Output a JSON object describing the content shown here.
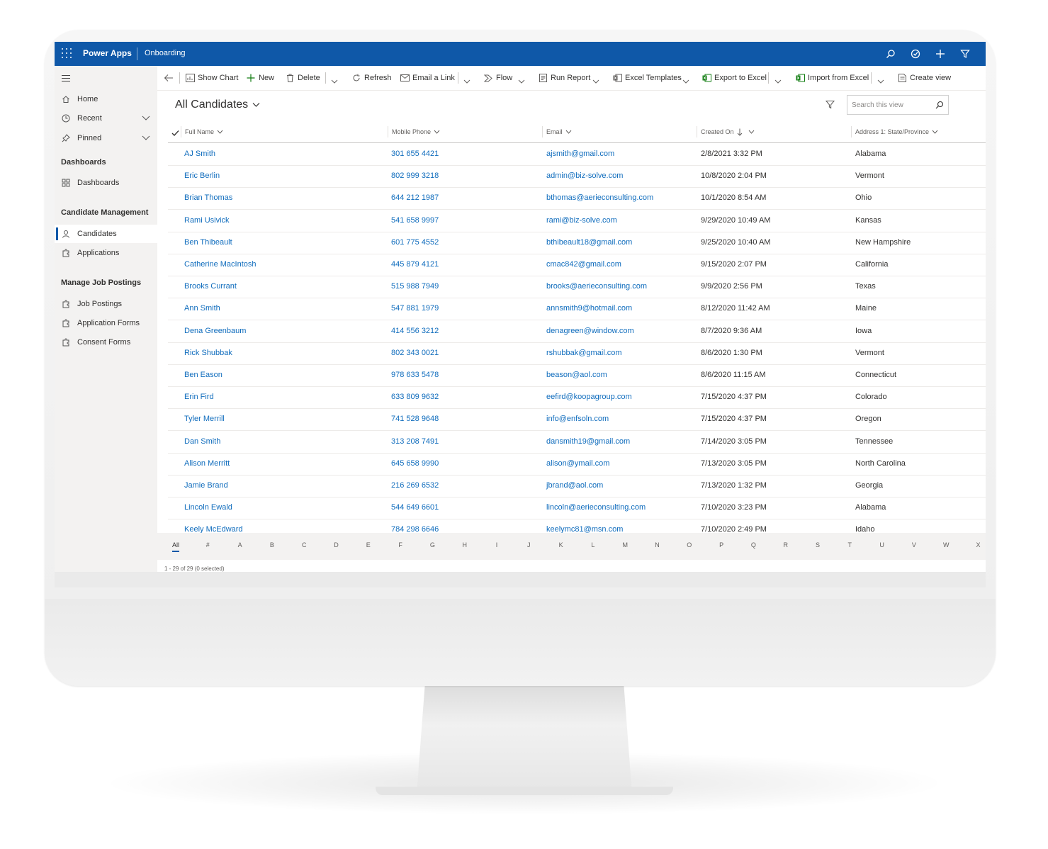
{
  "topbar": {
    "app_name": "Power Apps",
    "area": "Onboarding",
    "bg_color": "#0f58a8",
    "icons": [
      "search-icon",
      "assistant-icon",
      "new-icon",
      "advanced-filter-icon"
    ]
  },
  "sidebar": {
    "items": [
      {
        "label": "Home",
        "icon": "home-icon"
      },
      {
        "label": "Recent",
        "icon": "clock-icon"
      },
      {
        "label": "Pinned",
        "icon": "pin-icon"
      }
    ],
    "groups": [
      {
        "title": "Dashboards",
        "items": [
          {
            "label": "Dashboards",
            "icon": "dashboard-icon"
          }
        ]
      },
      {
        "title": "Candidate Management",
        "items": [
          {
            "label": "Candidates",
            "icon": "person-icon",
            "active": true
          },
          {
            "label": "Applications",
            "icon": "puzzle-icon"
          }
        ]
      },
      {
        "title": "Manage Job Postings",
        "items": [
          {
            "label": "Job Postings",
            "icon": "puzzle-icon"
          },
          {
            "label": "Application Forms",
            "icon": "puzzle-icon"
          },
          {
            "label": "Consent Forms",
            "icon": "puzzle-icon"
          }
        ]
      }
    ]
  },
  "commands": {
    "show_chart": "Show Chart",
    "new": "New",
    "delete": "Delete",
    "refresh": "Refresh",
    "email_link": "Email a Link",
    "flow": "Flow",
    "run_report": "Run Report",
    "excel_templates": "Excel Templates",
    "export_excel": "Export to Excel",
    "import_excel": "Import from Excel",
    "create_view": "Create view"
  },
  "view": {
    "title": "All Candidates",
    "search_placeholder": "Search this view"
  },
  "columns": [
    "Full Name",
    "Mobile Phone",
    "Email",
    "Created On",
    "Address 1: State/Province"
  ],
  "rows": [
    [
      "AJ Smith",
      "301 655 4421",
      "ajsmith@gmail.com",
      "2/8/2021 3:32 PM",
      "Alabama"
    ],
    [
      "Eric Berlin",
      "802 999 3218",
      "admin@biz-solve.com",
      "10/8/2020 2:04 PM",
      "Vermont"
    ],
    [
      "Brian Thomas",
      "644 212 1987",
      "bthomas@aerieconsulting.com",
      "10/1/2020 8:54 AM",
      "Ohio"
    ],
    [
      "Rami Usivick",
      "541 658 9997",
      "rami@biz-solve.com",
      "9/29/2020 10:49 AM",
      "Kansas"
    ],
    [
      "Ben Thibeault",
      "601 775 4552",
      "bthibeault18@gmail.com",
      "9/25/2020 10:40 AM",
      "New Hampshire"
    ],
    [
      "Catherine MacIntosh",
      "445 879 4121",
      "cmac842@gmail.com",
      "9/15/2020 2:07 PM",
      "California"
    ],
    [
      "Brooks Currant",
      "515 988 7949",
      "brooks@aerieconsulting.com",
      "9/9/2020 2:56 PM",
      "Texas"
    ],
    [
      "Ann Smith",
      "547 881 1979",
      "annsmith9@hotmail.com",
      "8/12/2020 11:42 AM",
      "Maine"
    ],
    [
      "Dena Greenbaum",
      "414 556 3212",
      "denagreen@window.com",
      "8/7/2020 9:36 AM",
      "Iowa"
    ],
    [
      "Rick Shubbak",
      "802 343 0021",
      "rshubbak@gmail.com",
      "8/6/2020 1:30 PM",
      "Vermont"
    ],
    [
      "Ben Eason",
      "978 633 5478",
      "beason@aol.com",
      "8/6/2020 11:15 AM",
      "Connecticut"
    ],
    [
      "Erin Fird",
      "633 809 9632",
      "eefird@koopagroup.com",
      "7/15/2020 4:37 PM",
      "Colorado"
    ],
    [
      "Tyler Merrill",
      "741 528 9648",
      "info@enfsoln.com",
      "7/15/2020 4:37 PM",
      "Oregon"
    ],
    [
      "Dan Smith",
      "313 208 7491",
      "dansmith19@gmail.com",
      "7/14/2020 3:05 PM",
      "Tennessee"
    ],
    [
      "Alison Merritt",
      "645 658 9990",
      "alison@ymail.com",
      "7/13/2020 3:05 PM",
      "North Carolina"
    ],
    [
      "Jamie Brand",
      "216 269 6532",
      "jbrand@aol.com",
      "7/13/2020 1:32 PM",
      "Georgia"
    ],
    [
      "Lincoln Ewald",
      "544 649 6601",
      "lincoln@aerieconsulting.com",
      "7/10/2020 3:23 PM",
      "Alabama"
    ],
    [
      "Keely McEdward",
      "784 298 6646",
      "keelymc81@msn.com",
      "7/10/2020 2:49 PM",
      "Idaho"
    ]
  ],
  "alphabet": [
    "All",
    "#",
    "A",
    "B",
    "C",
    "D",
    "E",
    "F",
    "G",
    "H",
    "I",
    "J",
    "K",
    "L",
    "M",
    "N",
    "O",
    "P",
    "Q",
    "R",
    "S",
    "T",
    "U",
    "V",
    "W",
    "X"
  ],
  "footer": "1 - 29 of 29 (0 selected)"
}
